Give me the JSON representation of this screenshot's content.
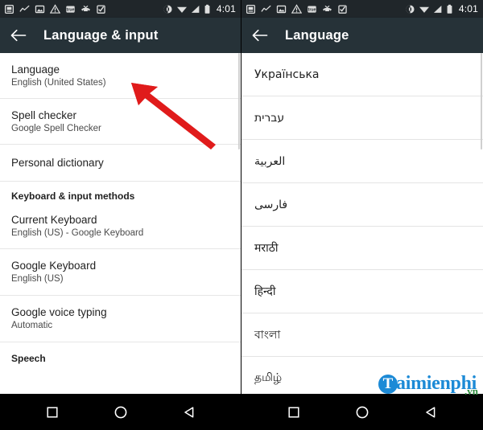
{
  "status_bar": {
    "time": "4:01",
    "left_icons": [
      {
        "name": "sim-card-icon"
      },
      {
        "name": "activity-graph-icon"
      },
      {
        "name": "image-icon"
      },
      {
        "name": "warning-triangle-icon"
      },
      {
        "name": "true-badge-icon"
      },
      {
        "name": "missed-call-icon"
      },
      {
        "name": "checklist-clipboard-icon"
      }
    ],
    "right_icons": [
      {
        "name": "vibrate-mode-icon"
      },
      {
        "name": "wifi-icon"
      },
      {
        "name": "cell-signal-icon"
      },
      {
        "name": "battery-icon"
      }
    ]
  },
  "left_screen": {
    "appbar": {
      "back_icon": "back-arrow-icon",
      "title": "Language & input"
    },
    "items": [
      {
        "type": "item",
        "title": "Language",
        "subtitle": "English (United States)",
        "name": "language"
      },
      {
        "type": "item",
        "title": "Spell checker",
        "subtitle": "Google Spell Checker",
        "name": "spell-checker"
      },
      {
        "type": "item",
        "title": "Personal dictionary",
        "subtitle": "",
        "name": "personal-dictionary"
      },
      {
        "type": "header",
        "title": "Keyboard & input methods",
        "name": "keyboard-input-methods"
      },
      {
        "type": "item",
        "title": "Current Keyboard",
        "subtitle": "English (US) - Google Keyboard",
        "name": "current-keyboard"
      },
      {
        "type": "item",
        "title": "Google Keyboard",
        "subtitle": "English (US)",
        "name": "google-keyboard"
      },
      {
        "type": "item",
        "title": "Google voice typing",
        "subtitle": "Automatic",
        "name": "google-voice-typing"
      },
      {
        "type": "header",
        "title": "Speech",
        "name": "speech"
      }
    ],
    "annotation": {
      "name": "red-arrow-pointing-to-language",
      "color": "#e01b1b"
    }
  },
  "right_screen": {
    "appbar": {
      "back_icon": "back-arrow-icon",
      "title": "Language"
    },
    "languages": [
      {
        "label": "Українська",
        "dir": "ltr",
        "name": "ukrainian"
      },
      {
        "label": "עברית",
        "dir": "rtl",
        "name": "hebrew"
      },
      {
        "label": "العربية",
        "dir": "rtl",
        "name": "arabic"
      },
      {
        "label": "فارسی",
        "dir": "rtl",
        "name": "persian"
      },
      {
        "label": "मराठी",
        "dir": "ltr",
        "name": "marathi"
      },
      {
        "label": "हिन्दी",
        "dir": "ltr",
        "name": "hindi"
      },
      {
        "label": "বাংলা",
        "dir": "ltr",
        "name": "bengali"
      },
      {
        "label": "தமிழ்",
        "dir": "ltr",
        "name": "tamil"
      }
    ]
  },
  "nav_bar": {
    "buttons": [
      {
        "name": "recents-button",
        "icon": "square-icon"
      },
      {
        "name": "home-button",
        "icon": "circle-icon"
      },
      {
        "name": "back-button",
        "icon": "triangle-left-icon"
      }
    ]
  },
  "watermark": {
    "badge": "T",
    "text": "aimienphi",
    "tld": ".vn",
    "badge_color": "#1c8ad6",
    "tld_color": "#2e8b3d"
  },
  "colors": {
    "status_bar": "#20262a",
    "app_bar": "#263238",
    "list_bg": "#ffffff",
    "nav_bar": "#000000",
    "divider": "#e6e6e6",
    "accent_red": "#e01b1b"
  }
}
